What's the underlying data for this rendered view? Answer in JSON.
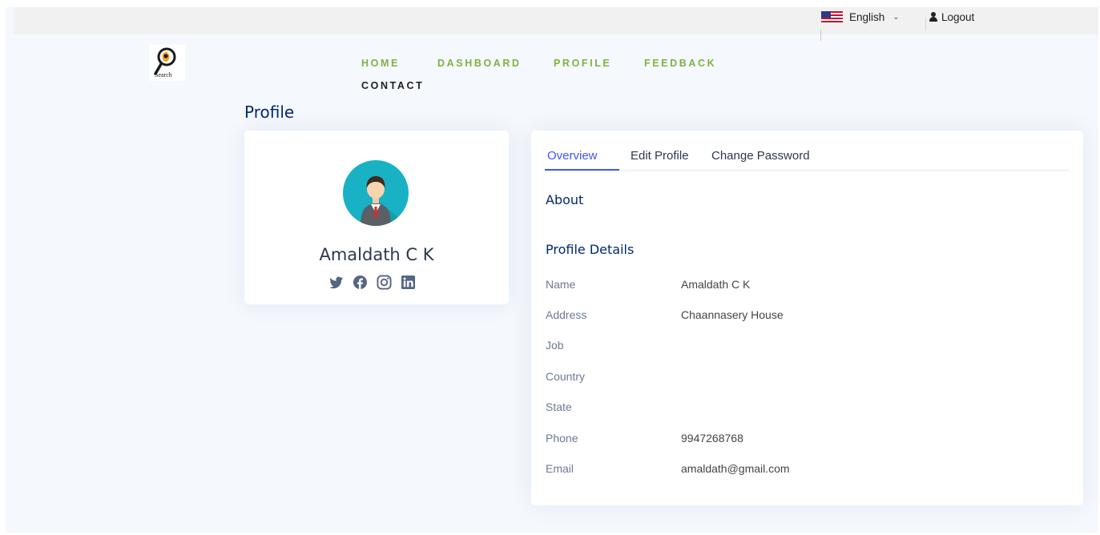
{
  "topbar": {
    "language": "English",
    "logout": "Logout"
  },
  "logo": {
    "caption": "Search"
  },
  "nav": {
    "items": [
      {
        "label": "HOME"
      },
      {
        "label": "DASHBOARD"
      },
      {
        "label": "PROFILE"
      },
      {
        "label": "FEEDBACK"
      },
      {
        "label": "CONTACT"
      }
    ]
  },
  "page": {
    "title": "Profile"
  },
  "profile_card": {
    "name": "Amaldath C K",
    "socials": [
      "twitter-icon",
      "facebook-icon",
      "instagram-icon",
      "linkedin-icon"
    ]
  },
  "tabs": [
    {
      "label": "Overview",
      "active": true
    },
    {
      "label": "Edit Profile",
      "active": false
    },
    {
      "label": "Change Password",
      "active": false
    }
  ],
  "overview": {
    "about_title": "About",
    "details_title": "Profile Details",
    "fields": [
      {
        "label": "Name",
        "value": "Amaldath C K"
      },
      {
        "label": "Address",
        "value": "Chaannasery House"
      },
      {
        "label": "Job",
        "value": ""
      },
      {
        "label": "Country",
        "value": ""
      },
      {
        "label": "State",
        "value": ""
      },
      {
        "label": "Phone",
        "value": "9947268768"
      },
      {
        "label": "Email",
        "value": "amaldath@gmail.com"
      }
    ]
  },
  "colors": {
    "nav_green": "#7cb342",
    "accent": "#4154f1",
    "heading": "#012970",
    "avatar_bg": "#19b2c5",
    "page_bg": "#f5f8fd"
  }
}
